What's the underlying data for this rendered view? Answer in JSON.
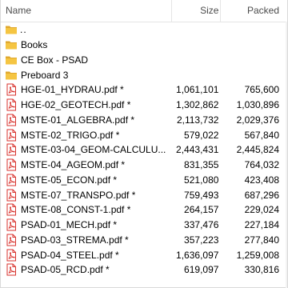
{
  "columns": {
    "name": "Name",
    "size": "Size",
    "packed": "Packed"
  },
  "parent_row": {
    "label": ".."
  },
  "folders": [
    {
      "name": "Books"
    },
    {
      "name": "CE Box - PSAD"
    },
    {
      "name": "Preboard 3"
    }
  ],
  "files": [
    {
      "name": "HGE-01_HYDRAU.pdf *",
      "size": "1,061,101",
      "packed": "765,600"
    },
    {
      "name": "HGE-02_GEOTECH.pdf *",
      "size": "1,302,862",
      "packed": "1,030,896"
    },
    {
      "name": "MSTE-01_ALGEBRA.pdf *",
      "size": "2,113,732",
      "packed": "2,029,376"
    },
    {
      "name": "MSTE-02_TRIGO.pdf *",
      "size": "579,022",
      "packed": "567,840"
    },
    {
      "name": "MSTE-03-04_GEOM-CALCULU...",
      "size": "2,443,431",
      "packed": "2,445,824"
    },
    {
      "name": "MSTE-04_AGEOM.pdf *",
      "size": "831,355",
      "packed": "764,032"
    },
    {
      "name": "MSTE-05_ECON.pdf *",
      "size": "521,080",
      "packed": "423,408"
    },
    {
      "name": "MSTE-07_TRANSPO.pdf *",
      "size": "759,493",
      "packed": "687,296"
    },
    {
      "name": "MSTE-08_CONST-1.pdf *",
      "size": "264,157",
      "packed": "229,024"
    },
    {
      "name": "PSAD-01_MECH.pdf *",
      "size": "337,476",
      "packed": "227,184"
    },
    {
      "name": "PSAD-03_STREMA.pdf *",
      "size": "357,223",
      "packed": "277,840"
    },
    {
      "name": "PSAD-04_STEEL.pdf *",
      "size": "1,636,097",
      "packed": "1,259,008"
    },
    {
      "name": "PSAD-05_RCD.pdf *",
      "size": "619,097",
      "packed": "330,816"
    }
  ],
  "colors": {
    "folder": "#f5c542",
    "folder_dark": "#e0a82e",
    "pdf_red": "#d8322c"
  },
  "icons": {
    "folder": "folder-icon",
    "parent": "parent-folder-icon",
    "pdf": "pdf-file-icon"
  }
}
